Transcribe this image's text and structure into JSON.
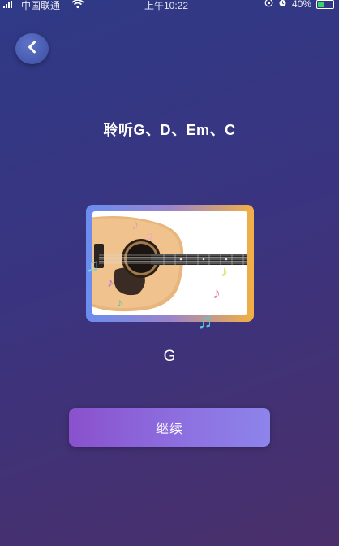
{
  "status": {
    "carrier": "中国联通",
    "time": "上午10:22",
    "battery": "40%",
    "battery_level": 0.4
  },
  "back_button": {
    "icon": "chevron-left-icon"
  },
  "title": "聆听G、D、Em、C",
  "current_chord": "G",
  "continue_label": "继续",
  "colors": {
    "background_start": "#2f3a86",
    "background_end": "#4a2f6a",
    "button_start": "#8a51cd",
    "button_end": "#8d84ea"
  }
}
